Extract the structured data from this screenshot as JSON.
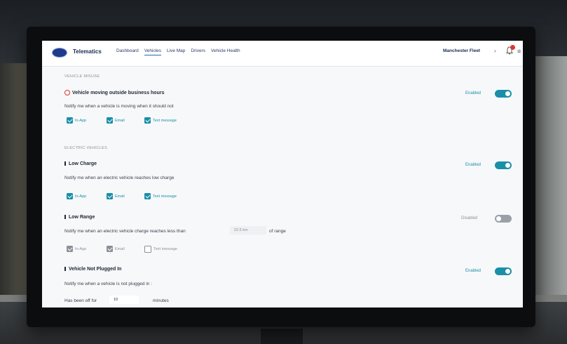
{
  "app": {
    "brand": "Telematics"
  },
  "nav": {
    "items": [
      "Dashboard",
      "Vehicles",
      "Live Map",
      "Drivers",
      "Vehicle Health"
    ],
    "active_index": 1
  },
  "account": {
    "fleet": "Manchester Fleet",
    "notification_count": "1"
  },
  "sections": {
    "vehicle_misuse": "VEHICLE MISUSE",
    "electric_vehicles": "ELECTRIC VEHICLES"
  },
  "alerts": {
    "outside_hours": {
      "title": "Vehicle moving outside business hours",
      "desc": "Notify me when a vehicle is moving when it should not",
      "status": "Enabled",
      "options": [
        "In-App",
        "Email",
        "Text message"
      ]
    },
    "low_charge": {
      "title": "Low Charge",
      "desc": "Notify me when an electric vehicle reaches low charge",
      "status": "Enabled",
      "options": [
        "In-App",
        "Email",
        "Text message"
      ]
    },
    "low_range": {
      "title": "Low Range",
      "desc": "Notify me when an electric vehicle charge reaches less than",
      "input_placeholder": "22.5 km",
      "suffix": "of range",
      "status": "Disabled",
      "options": [
        "In-App",
        "Email",
        "Text message"
      ]
    },
    "not_plugged": {
      "title": "Vehicle Not Plugged In",
      "desc": "Notify me when a vehicle is not plugged in :",
      "off_label": "Has been off for",
      "off_value": "10",
      "off_unit": "minutes",
      "status": "Enabled"
    }
  },
  "colors": {
    "accent": "#1a8fa8",
    "brand": "#1b2a55",
    "badge": "#e0382d"
  }
}
